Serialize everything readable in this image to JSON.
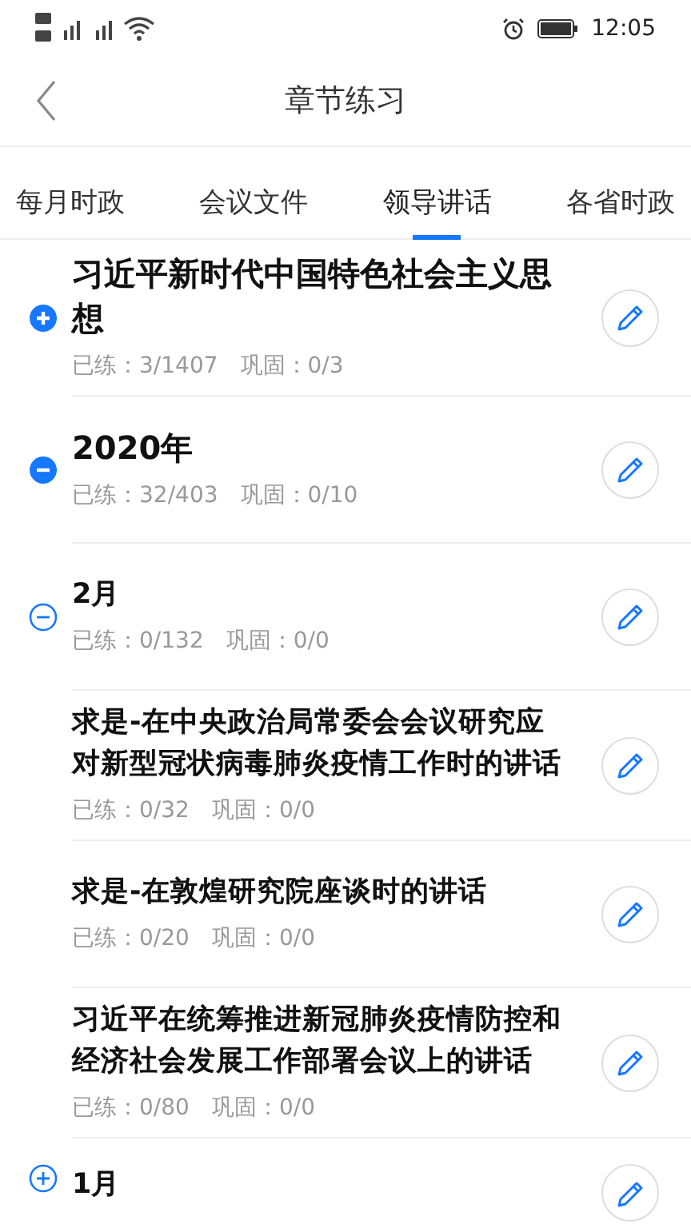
{
  "status_bar": {
    "time": "12:05"
  },
  "header": {
    "title": "章节练习"
  },
  "tabs": [
    {
      "label": "每月时政",
      "selected": false
    },
    {
      "label": "会议文件",
      "selected": false
    },
    {
      "label": "领导讲话",
      "selected": true
    },
    {
      "label": "各省时政",
      "selected": false
    }
  ],
  "tree": [
    {
      "title": "习近平新时代中国特色社会主义思想",
      "expanded": false,
      "stats": "已练：3/1407　巩固：0/3"
    },
    {
      "title": "2020年",
      "expanded": true,
      "stats": "已练：32/403　巩固：0/10",
      "children": [
        {
          "title": "2月",
          "expanded": true,
          "stats": "已练：0/132　巩固：0/0",
          "children": [
            {
              "title": "求是-在中央政治局常委会会议研究应对新型冠状病毒肺炎疫情工作时的讲话",
              "stats": "已练：0/32　巩固：0/0"
            },
            {
              "title": "求是-在敦煌研究院座谈时的讲话",
              "stats": "已练：0/20　巩固：0/0"
            },
            {
              "title": "习近平在统筹推进新冠肺炎疫情防控和经济社会发展工作部署会议上的讲话",
              "stats": "已练：0/80　巩固：0/0"
            }
          ]
        },
        {
          "title": "1月",
          "expanded": false
        }
      ]
    }
  ]
}
